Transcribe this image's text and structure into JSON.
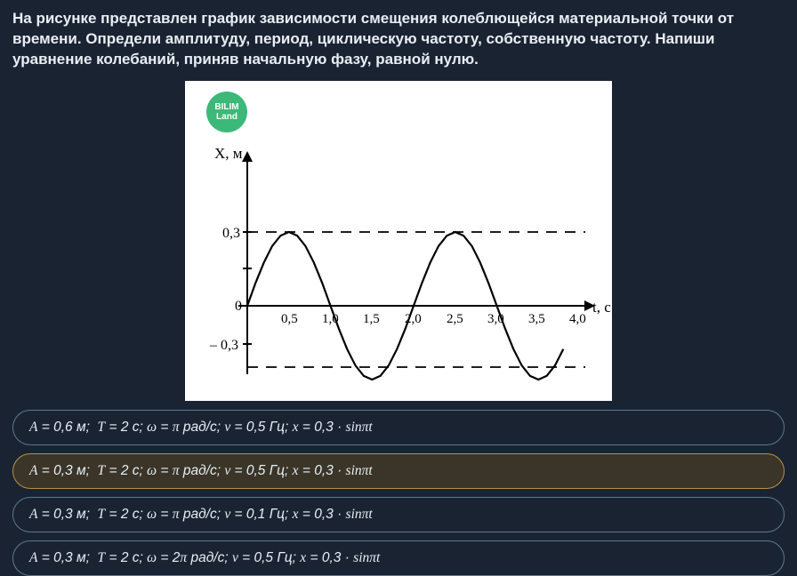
{
  "question": "На рисунке представлен график зависимости смещения колеблющейся материальной точки от времени. Определи амплитуду, период, циклическую частоту, собственную частоту. Напиши уравнение колебаний, приняв начальную фазу, равной нулю.",
  "badge": {
    "line1": "BILIM",
    "line2": "Land"
  },
  "answers": [
    {
      "text_html": "<span class='mi'>A</span> = 0,6 м; &nbsp;<span class='mi'>T</span> = 2 с; <span class='mi'>ω</span> = <span class='mi'>π</span> рад/с; <span class='mi'>ν</span> = 0,5 Гц; <span class='mi'>x</span> = 0,3 · <span class='mi'>sinπt</span>",
      "selected": false
    },
    {
      "text_html": "<span class='mi'>A</span> = 0,3 м; &nbsp;<span class='mi'>T</span> = 2 с; <span class='mi'>ω</span> = <span class='mi'>π</span> рад/с; <span class='mi'>ν</span> = 0,5 Гц; <span class='mi'>x</span> = 0,3 · <span class='mi'>sinπt</span>",
      "selected": true
    },
    {
      "text_html": "<span class='mi'>A</span> = 0,3 м; &nbsp;<span class='mi'>T</span> = 2 с; <span class='mi'>ω</span> = <span class='mi'>π</span> рад/с; <span class='mi'>ν</span> = 0,1 Гц; <span class='mi'>x</span> = 0,3 · <span class='mi'>sinπt</span>",
      "selected": false
    },
    {
      "text_html": "<span class='mi'>A</span> = 0,3 м; &nbsp;<span class='mi'>T</span> = 2 с; <span class='mi'>ω</span> = 2<span class='mi'>π</span> рад/с; <span class='mi'>ν</span> = 0,5 Гц; <span class='mi'>x</span> = 0,3 · <span class='mi'>sinπt</span>",
      "selected": false
    }
  ],
  "chart_data": {
    "type": "line",
    "title": "",
    "xlabel": "t, с",
    "ylabel": "X, м",
    "amplitude": 0.3,
    "period": 2.0,
    "x_ticks": [
      "0,5",
      "1,0",
      "1,5",
      "2,0",
      "2,5",
      "3,0",
      "3,5",
      "4,0"
    ],
    "y_ticks": [
      "0,3",
      "0",
      "– 0,3"
    ],
    "xlim": [
      0,
      4.0
    ],
    "ylim": [
      -0.4,
      0.4
    ],
    "dashed_lines_y": [
      0.3,
      -0.3
    ],
    "series": [
      {
        "name": "displacement",
        "x": [
          0,
          0.1,
          0.2,
          0.3,
          0.4,
          0.5,
          0.6,
          0.7,
          0.8,
          0.9,
          1.0,
          1.1,
          1.2,
          1.3,
          1.4,
          1.5,
          1.6,
          1.7,
          1.8,
          1.9,
          2.0,
          2.1,
          2.2,
          2.3,
          2.4,
          2.5,
          2.6,
          2.7,
          2.8,
          2.9,
          3.0,
          3.1,
          3.2,
          3.3,
          3.4,
          3.5,
          3.6,
          3.7,
          3.8
        ],
        "y": [
          0,
          0.093,
          0.176,
          0.243,
          0.285,
          0.3,
          0.285,
          0.243,
          0.176,
          0.093,
          0,
          -0.093,
          -0.176,
          -0.243,
          -0.285,
          -0.3,
          -0.285,
          -0.243,
          -0.176,
          -0.093,
          0,
          0.093,
          0.176,
          0.243,
          0.285,
          0.3,
          0.285,
          0.243,
          0.176,
          0.093,
          0,
          -0.093,
          -0.176,
          -0.243,
          -0.285,
          -0.3,
          -0.285,
          -0.243,
          -0.176
        ]
      }
    ]
  }
}
